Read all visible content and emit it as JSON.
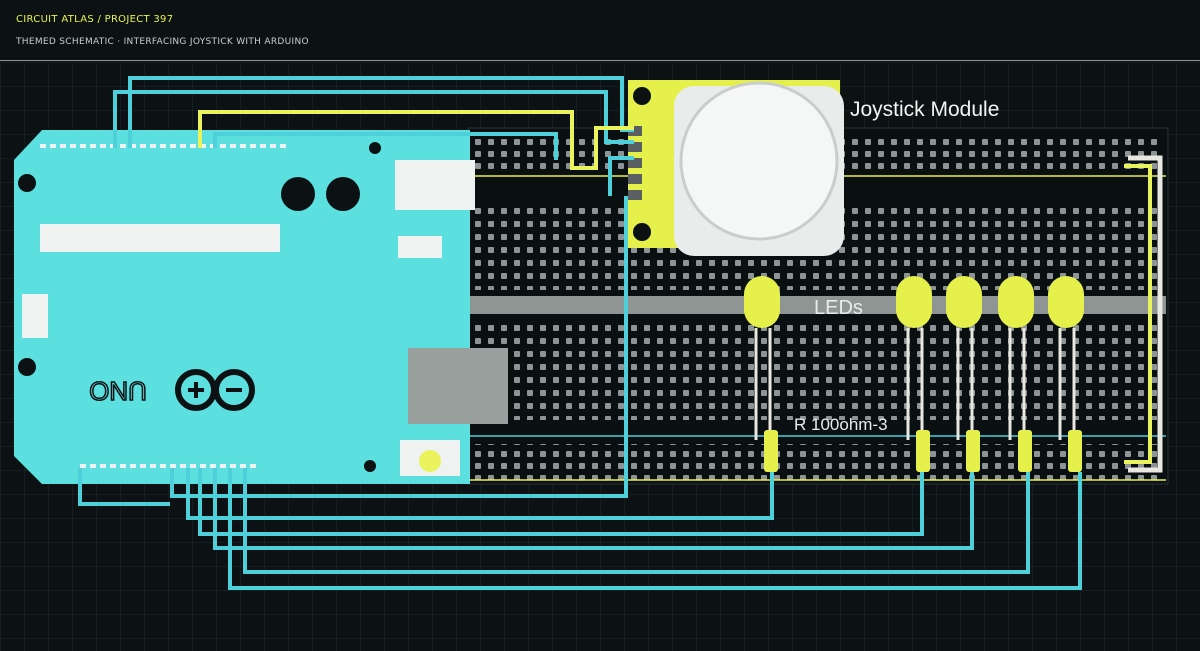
{
  "header": {
    "breadcrumb": "CIRCUIT ATLAS / PROJECT 397",
    "subtitle": "THEMED SCHEMATIC · INTERFACING JOYSTICK WITH ARDUINO"
  },
  "board": {
    "logo_text": "UNO"
  },
  "labels": {
    "joystick": "Joystick Module",
    "leds": "LEDs",
    "resistors": "R 100ohm-3"
  },
  "colors": {
    "background": "#0c1114",
    "arduino": "#5ce0df",
    "wire": "#4dd0da",
    "accent": "#eaf35b",
    "breadboard": "#0a0f12",
    "header_rule": "#8a9a92"
  }
}
